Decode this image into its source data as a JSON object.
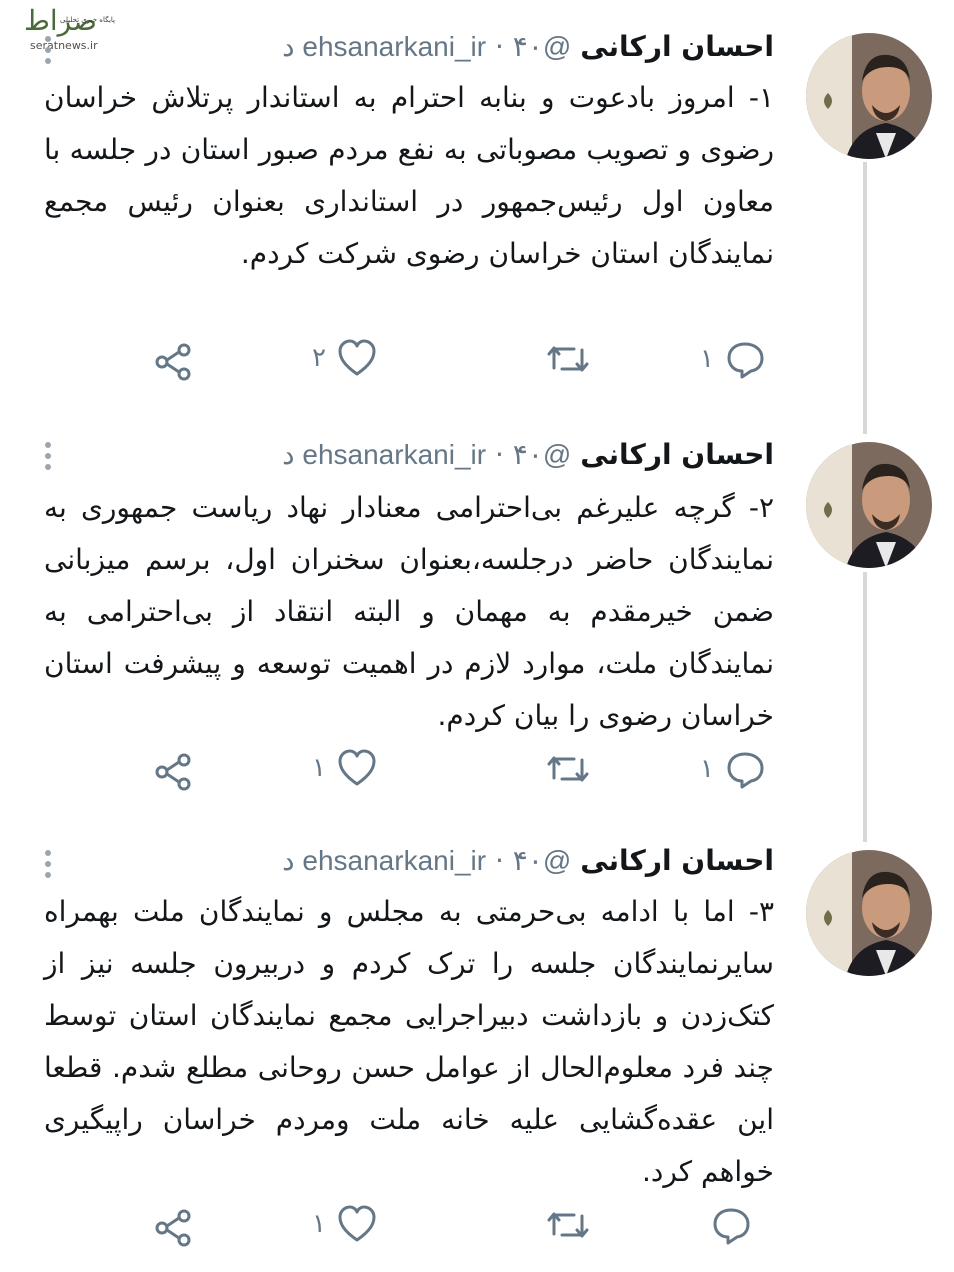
{
  "watermark": {
    "mark": "صراط",
    "tagline": "پایگاه خبری تحلیلی",
    "site": "seratnews.ir"
  },
  "tweets": [
    {
      "name": "احسان ارکانی",
      "handle": "@ehsanarkani_ir",
      "time": "۴۰ د",
      "text": "۱- امروز بادعوت و بنابه احترام به استاندار پرتلاش خراسان رضوی و تصویب مصوباتی به نفع مردم صبور استان در جلسه با معاون اول رئیس‌جمهور در استانداری بعنوان رئیس مجمع نمایندگان استان خراسان رضوی شرکت کردم.",
      "reply_count": "۱",
      "retweet_count": "",
      "like_count": "۲"
    },
    {
      "name": "احسان ارکانی",
      "handle": "@ehsanarkani_ir",
      "time": "۴۰ د",
      "text": "۲- گرچه علیرغم بی‌احترامی معنادار نهاد ریاست جمهوری به نمایندگان حاضر درجلسه،بعنوان سخنران اول، برسم میزبانی ضمن خیرمقدم به مهمان و البته انتقاد از بی‌احترامی به نمایندگان ملت، موارد لازم در اهمیت توسعه و پیشرفت استان خراسان رضوی را بیان کردم.",
      "reply_count": "۱",
      "retweet_count": "",
      "like_count": "۱"
    },
    {
      "name": "احسان ارکانی",
      "handle": "@ehsanarkani_ir",
      "time": "۴۰ د",
      "text": "۳- اما با ادامه بی‌حرمتی به مجلس و نمایندگان ملت بهمراه سایرنمایندگان جلسه را ترک کردم و دربیرون جلسه نیز از کتک‌زدن و بازداشت دبیراجرایی مجمع نمایندگان استان توسط چند فرد معلوم‌الحال از عوامل حسن روحانی مطلع شدم. قطعا این عقده‌گشایی علیه خانه ملت ومردم خراسان راپیگیری خواهم کرد.",
      "reply_count": "",
      "retweet_count": "",
      "like_count": "۱"
    }
  ]
}
